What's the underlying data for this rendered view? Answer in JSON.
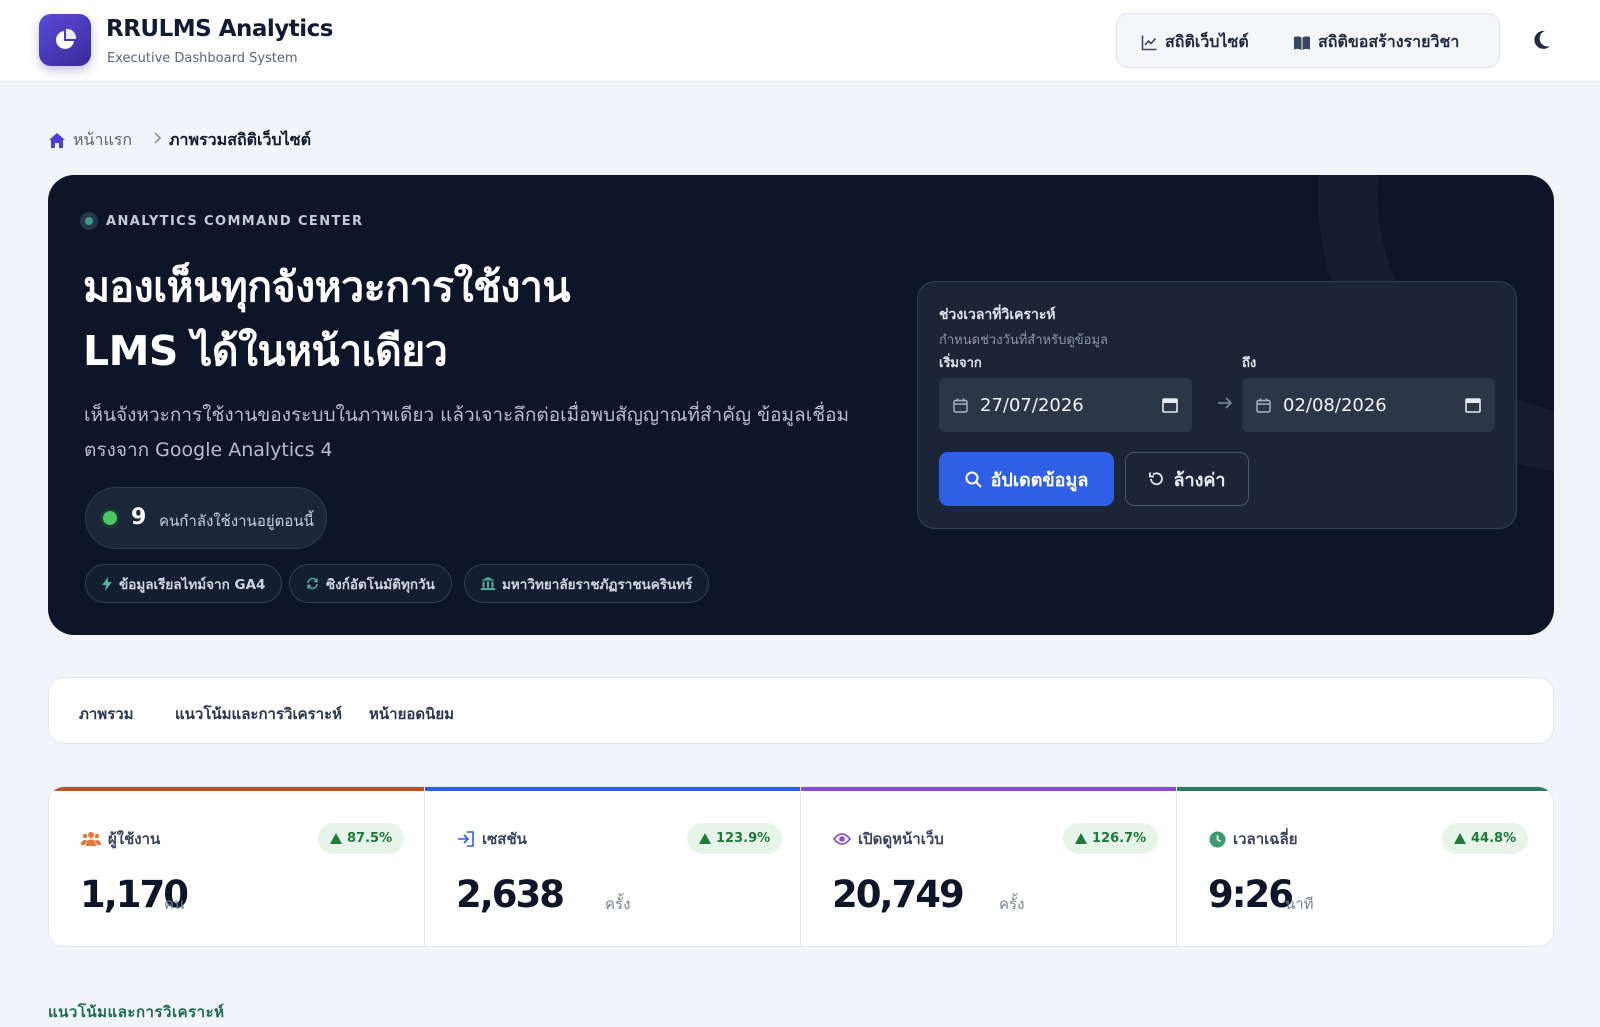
{
  "header": {
    "brand_title": "RRULMS Analytics",
    "brand_subtitle": "Executive Dashboard System",
    "nav": [
      {
        "label": "สถิติเว็บไซต์",
        "icon": "line-chart-icon"
      },
      {
        "label": "สถิติขอสร้างรายวิชา",
        "icon": "book-icon"
      }
    ],
    "theme_toggle_icon": "moon-icon"
  },
  "breadcrumb": {
    "home": "หน้าแรก",
    "current": "ภาพรวมสถิติเว็บไซต์"
  },
  "hero": {
    "eyebrow": "ANALYTICS COMMAND CENTER",
    "headline_line1": "มองเห็นทุกจังหวะการใช้งาน",
    "headline_line2": "LMS ได้ในหน้าเดียว",
    "description": "เห็นจังหวะการใช้งานของระบบในภาพเดียว แล้วเจาะลึกต่อเมื่อพบสัญญาณที่สำคัญ ข้อมูลเชื่อมตรงจาก Google Analytics 4",
    "live_count": "9",
    "live_label": "คนกำลังใช้งานอยู่ตอนนี้",
    "chips": [
      {
        "label": "ข้อมูลเรียลไทม์จาก GA4",
        "icon": "bolt-icon"
      },
      {
        "label": "ซิงก์อัตโนมัติทุกวัน",
        "icon": "sync-icon"
      },
      {
        "label": "มหาวิทยาลัยราชภัฏราชนครินทร์",
        "icon": "university-icon"
      }
    ]
  },
  "date_panel": {
    "title": "ช่วงเวลาที่วิเคราะห์",
    "subtitle": "กำหนดช่วงวันที่สำหรับดูข้อมูล",
    "start_label": "เริ่มจาก",
    "end_label": "ถึง",
    "start_value": "27/07/2026",
    "end_value": "02/08/2026",
    "update_button": "อัปเดตข้อมูล",
    "reset_button": "ล้างค่า"
  },
  "tabs": [
    "ภาพรวม",
    "แนวโน้มและการวิเคราะห์",
    "หน้ายอดนิยม"
  ],
  "stats": [
    {
      "label": "ผู้ใช้งาน",
      "change": "87.5%",
      "value": "1,170",
      "unit": "คน",
      "icon": "users-icon",
      "color": "#b5532a"
    },
    {
      "label": "เซสชัน",
      "change": "123.9%",
      "value": "2,638",
      "unit": "ครั้ง",
      "icon": "sign-in-icon",
      "color": "#2f5fe6"
    },
    {
      "label": "เปิดดูหน้าเว็บ",
      "change": "126.7%",
      "value": "20,749",
      "unit": "ครั้ง",
      "icon": "eye-icon",
      "color": "#8a4fd0"
    },
    {
      "label": "เวลาเฉลี่ย",
      "change": "44.8%",
      "value": "9:26",
      "unit": "นาที",
      "icon": "clock-icon",
      "color": "#2f7a5e"
    }
  ],
  "section_title": "แนวโน้มและการวิเคราะห์"
}
